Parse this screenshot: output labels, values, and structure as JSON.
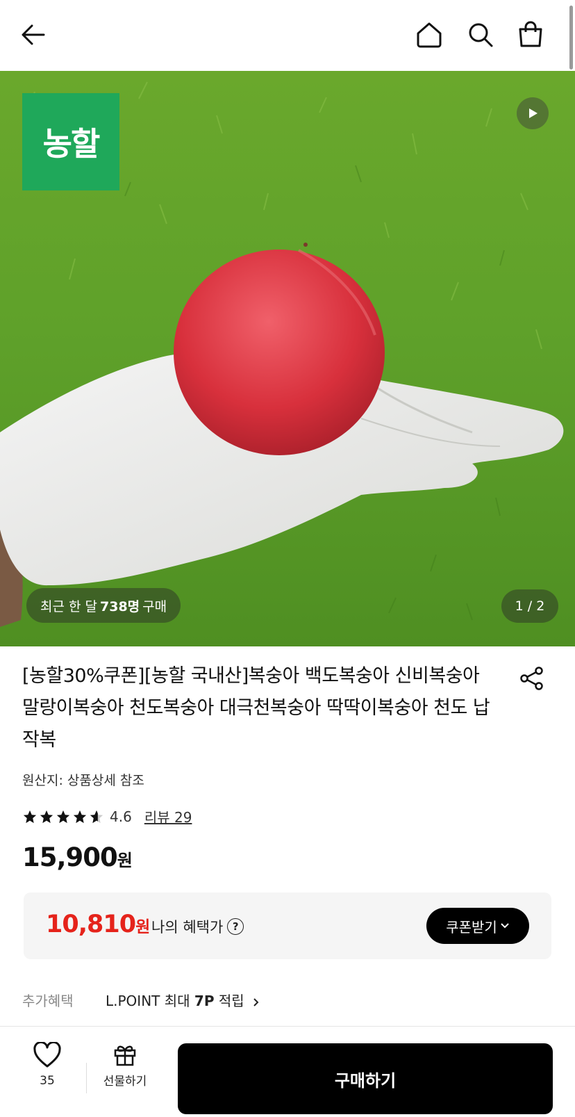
{
  "header": {
    "back": "back-arrow-icon",
    "home": "home-icon",
    "search": "search-icon",
    "cart": "shopping-bag-icon"
  },
  "hero": {
    "brand_logo": "농할",
    "recent_prefix": "최근 한 달",
    "recent_count": "738명",
    "recent_suffix": "구매",
    "page_counter": "1 / 2"
  },
  "product": {
    "title": "[농할30%쿠폰][농할 국내산]복숭아 백도복숭아 신비복숭아 말랑이복숭아 천도복숭아 대극천복숭아 딱딱이복숭아 천도 납작복",
    "origin": "원산지: 상품상세 참조",
    "rating": "4.6",
    "rating_value": 4.6,
    "review": "리뷰 29",
    "price": "15,900",
    "price_unit": "원"
  },
  "benefit": {
    "price": "10,810",
    "price_unit": "원",
    "label": "나의 혜택가",
    "coupon_button": "쿠폰받기"
  },
  "extra": {
    "label": "추가혜택",
    "lpoint_prefix": "L.POINT 최대 ",
    "lpoint_points": "7P",
    "lpoint_suffix": " 적립"
  },
  "bottom": {
    "like_count": "35",
    "gift_label": "선물하기",
    "buy_label": "구매하기"
  },
  "colors": {
    "brand_green": "#1fa85a",
    "sale_red": "#e5231b",
    "button_black": "#000000"
  }
}
